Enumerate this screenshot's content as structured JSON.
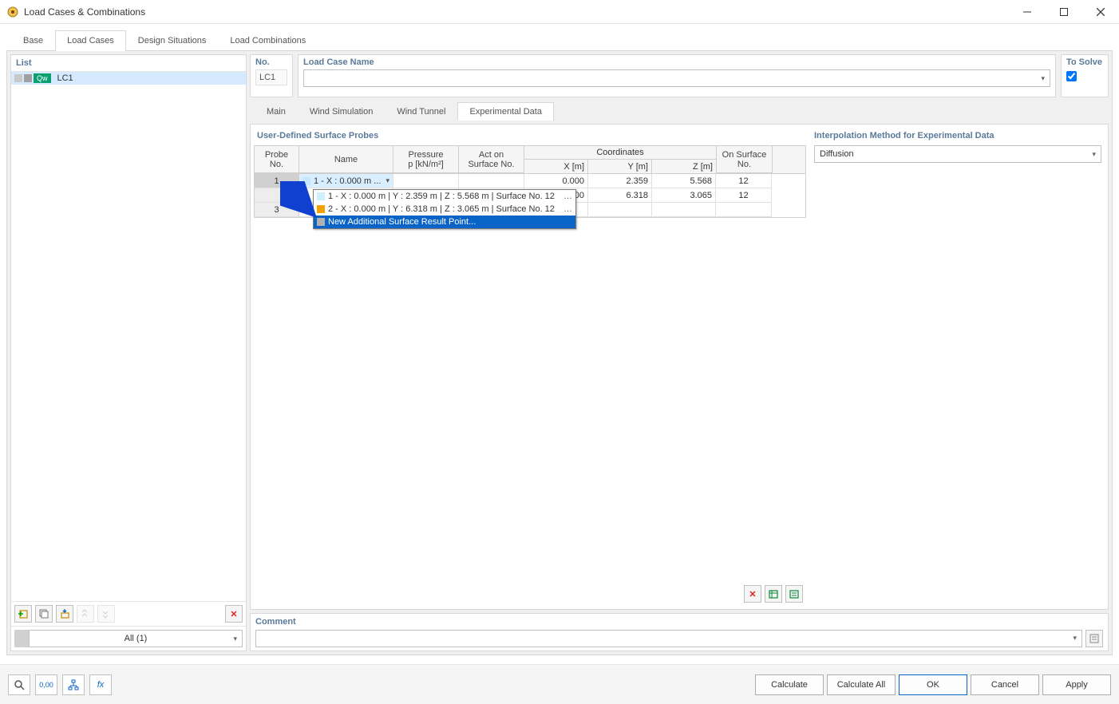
{
  "titlebar": {
    "title": "Load Cases & Combinations"
  },
  "main_tabs": [
    "Base",
    "Load Cases",
    "Design Situations",
    "Load Combinations"
  ],
  "main_tab_active": 1,
  "left": {
    "header": "List",
    "items": [
      {
        "badge": "Qw",
        "label": "LC1"
      }
    ],
    "filter": "All (1)"
  },
  "header_row": {
    "no_label": "No.",
    "no_value": "LC1",
    "name_label": "Load Case Name",
    "name_value": "",
    "solve_label": "To Solve",
    "solve_checked": true
  },
  "sub_tabs": [
    "Main",
    "Wind Simulation",
    "Wind Tunnel",
    "Experimental Data"
  ],
  "sub_tab_active": 3,
  "probes": {
    "title": "User-Defined Surface Probes",
    "headers": {
      "probe_no": "Probe\nNo.",
      "name": "Name",
      "pressure": "Pressure\np [kN/m²]",
      "act_on": "Act on\nSurface No.",
      "coords": "Coordinates",
      "x": "X [m]",
      "y": "Y [m]",
      "z": "Z [m]",
      "surface_no": "On Surface\nNo."
    },
    "rows": [
      {
        "no": "1",
        "name": "1 - X : 0.000 m ...",
        "swatch": "#c7e7ff",
        "x": "0.000",
        "y": "2.359",
        "z": "5.568",
        "surf": "12"
      },
      {
        "no": "",
        "name": "",
        "swatch": "",
        "x": ".000",
        "y": "6.318",
        "z": "3.065",
        "surf": "12",
        "ellipsis": "..."
      },
      {
        "no": "3",
        "name": "",
        "swatch": "",
        "x": "",
        "y": "",
        "z": "",
        "surf": ""
      }
    ],
    "dropdown": [
      {
        "label": "1 - X : 0.000 m | Y : 2.359 m | Z : 5.568 m | Surface No. 12",
        "swatch": "#cfeeff"
      },
      {
        "label": "2 - X : 0.000 m | Y : 6.318 m | Z : 3.065 m | Surface No. 12",
        "swatch": "#f7a000"
      },
      {
        "label": "New Additional Surface Result Point...",
        "swatch": "#b0b0b0",
        "selected": true
      }
    ]
  },
  "interp": {
    "title": "Interpolation Method for Experimental Data",
    "value": "Diffusion"
  },
  "comment": {
    "label": "Comment",
    "value": ""
  },
  "footer": {
    "calculate": "Calculate",
    "calculate_all": "Calculate All",
    "ok": "OK",
    "cancel": "Cancel",
    "apply": "Apply"
  }
}
